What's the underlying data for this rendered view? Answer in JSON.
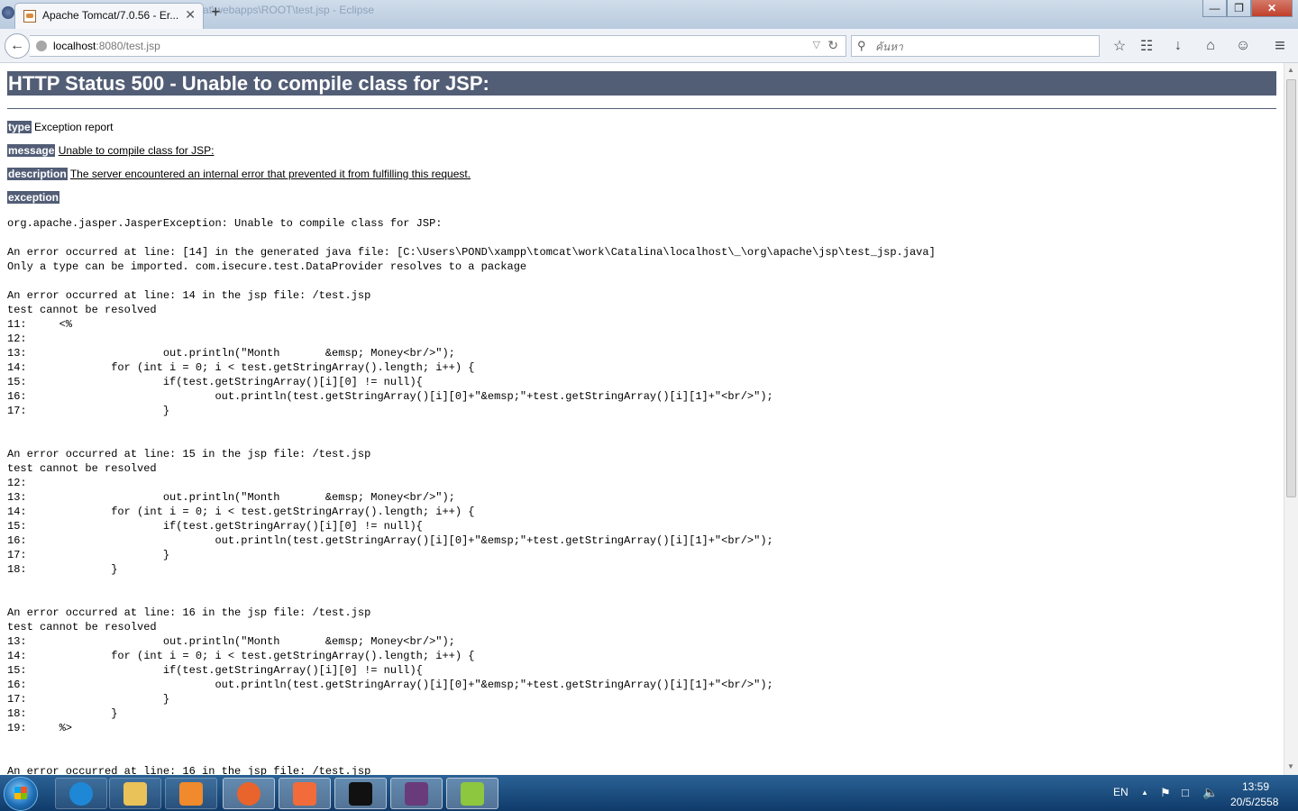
{
  "window": {
    "background_title": "at\\webapps\\ROOT\\test.jsp - Eclipse",
    "minimize": "—",
    "maximize": "❐",
    "close": "✕"
  },
  "tab": {
    "title": "Apache Tomcat/7.0.56 - Er...",
    "close": "✕",
    "new_tab": "+"
  },
  "navbar": {
    "back": "←",
    "url_host": "localhost",
    "url_path": ":8080/test.jsp",
    "dropdown": "▽",
    "reload": "↻",
    "search_placeholder": "ค้นหา",
    "search_icon": "⚲",
    "tools": {
      "bookmark": "☆",
      "reading_list": "☷",
      "download": "↓",
      "home": "⌂",
      "chat": "☺",
      "menu": "≡"
    }
  },
  "page": {
    "heading": "HTTP Status 500 - Unable to compile class for JSP:",
    "type_label": "type",
    "type_value": "Exception report",
    "message_label": "message",
    "message_value": "Unable to compile class for JSP:",
    "description_label": "description",
    "description_value": "The server encountered an internal error that prevented it from fulfilling this request.",
    "exception_label": "exception",
    "trace": "org.apache.jasper.JasperException: Unable to compile class for JSP:\n\nAn error occurred at line: [14] in the generated java file: [C:\\Users\\POND\\xampp\\tomcat\\work\\Catalina\\localhost\\_\\org\\apache\\jsp\\test_jsp.java]\nOnly a type can be imported. com.isecure.test.DataProvider resolves to a package\n\nAn error occurred at line: 14 in the jsp file: /test.jsp\ntest cannot be resolved\n11:     <%\n12:\n13:                     out.println(\"Month       &emsp; Money<br/>\");\n14:             for (int i = 0; i < test.getStringArray().length; i++) {\n15:                     if(test.getStringArray()[i][0] != null){\n16:                             out.println(test.getStringArray()[i][0]+\"&emsp;\"+test.getStringArray()[i][1]+\"<br/>\");\n17:                     }\n\n\nAn error occurred at line: 15 in the jsp file: /test.jsp\ntest cannot be resolved\n12:\n13:                     out.println(\"Month       &emsp; Money<br/>\");\n14:             for (int i = 0; i < test.getStringArray().length; i++) {\n15:                     if(test.getStringArray()[i][0] != null){\n16:                             out.println(test.getStringArray()[i][0]+\"&emsp;\"+test.getStringArray()[i][1]+\"<br/>\");\n17:                     }\n18:             }\n\n\nAn error occurred at line: 16 in the jsp file: /test.jsp\ntest cannot be resolved\n13:                     out.println(\"Month       &emsp; Money<br/>\");\n14:             for (int i = 0; i < test.getStringArray().length; i++) {\n15:                     if(test.getStringArray()[i][0] != null){\n16:                             out.println(test.getStringArray()[i][0]+\"&emsp;\"+test.getStringArray()[i][1]+\"<br/>\");\n17:                     }\n18:             }\n19:     %>\n\n\nAn error occurred at line: 16 in the jsp file: /test.jsp"
  },
  "scrollbar": {
    "up": "▲",
    "down": "▼"
  },
  "taskbar": {
    "apps": [
      {
        "name": "internet-explorer",
        "color": "#1e88d6",
        "active": false
      },
      {
        "name": "file-explorer",
        "color": "#e9c25a",
        "active": false
      },
      {
        "name": "media-player",
        "color": "#f08a2c",
        "active": false
      },
      {
        "name": "firefox",
        "color": "#e8642c",
        "active": true
      },
      {
        "name": "xampp",
        "color": "#f26b3a",
        "active": true
      },
      {
        "name": "command-prompt",
        "color": "#111111",
        "active": true
      },
      {
        "name": "eclipse-ee",
        "color": "#6a3b7a",
        "active": true
      },
      {
        "name": "notepad-plus-plus",
        "color": "#8dc63f",
        "active": true
      }
    ],
    "language": "EN",
    "tray_arrow": "▲",
    "time": "13:59",
    "date": "20/5/2558"
  },
  "colors": {
    "tomcat_heading_bg": "#525d76",
    "taskbar_top": "#2b6296",
    "taskbar_bottom": "#0f3b6b"
  }
}
